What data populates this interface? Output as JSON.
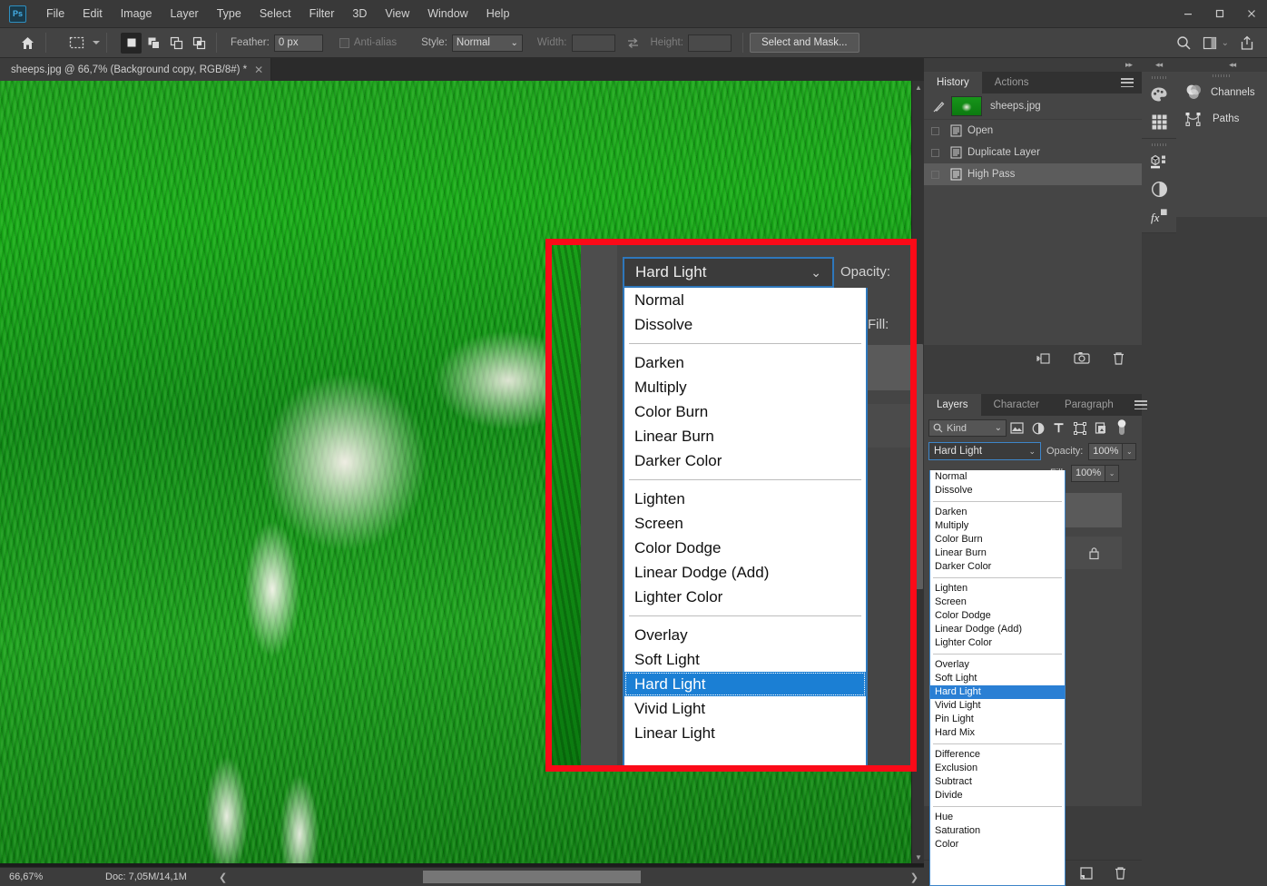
{
  "app": {
    "logo_text": "Ps",
    "menus": [
      "File",
      "Edit",
      "Image",
      "Layer",
      "Type",
      "Select",
      "Filter",
      "3D",
      "View",
      "Window",
      "Help"
    ],
    "window_controls": {
      "minimize": "—",
      "maximize": "◻",
      "close": "✕"
    }
  },
  "options_bar": {
    "home_icon": "home-icon",
    "tool_icon": "rectangular-marquee-icon",
    "selection_modes": [
      "new-selection",
      "add-to-selection",
      "subtract-from-selection",
      "intersect-selection"
    ],
    "feather_label": "Feather:",
    "feather_value": "0 px",
    "antialias_label": "Anti-alias",
    "antialias_checked": false,
    "style_label": "Style:",
    "style_value": "Normal",
    "width_label": "Width:",
    "width_value": "",
    "swap_icon": "swap-width-height-icon",
    "height_label": "Height:",
    "height_value": "",
    "select_and_mask_label": "Select and Mask...",
    "right_icons": [
      "search-icon",
      "workspace-icon",
      "share-icon"
    ]
  },
  "document": {
    "tab_title": "sheeps.jpg @ 66,7% (Background copy, RGB/8#) *",
    "close_glyph": "✕"
  },
  "status_bar": {
    "zoom": "66,67%",
    "doc_info": "Doc: 7,05M/14,1M",
    "expand_glyph": "❯",
    "left_arrow": "❮",
    "right_arrow": "❯"
  },
  "history_panel": {
    "tabs": [
      {
        "label": "History",
        "active": true
      },
      {
        "label": "Actions",
        "active": false
      }
    ],
    "menu_icon": "panel-menu-icon",
    "snapshot": {
      "label": "sheeps.jpg",
      "brush_icon": "history-brush-icon",
      "thumb": "document-thumbnail"
    },
    "states": [
      {
        "label": "Open",
        "selected": false,
        "icon": "history-state-icon"
      },
      {
        "label": "Duplicate Layer",
        "selected": false,
        "icon": "history-state-icon"
      },
      {
        "label": "High Pass",
        "selected": true,
        "icon": "history-state-icon"
      }
    ],
    "footer_icons": [
      "create-document-from-state-icon",
      "create-new-snapshot-icon",
      "delete-state-icon"
    ]
  },
  "icon_column": {
    "groups": [
      [
        "color-palette-icon",
        "swatches-grid-icon"
      ],
      [
        "properties-3d-icon",
        "adjustments-icon",
        "layer-styles-fx-icon"
      ]
    ]
  },
  "channels_paths": {
    "items": [
      {
        "label": "Channels",
        "icon": "channels-icon"
      },
      {
        "label": "Paths",
        "icon": "paths-icon"
      }
    ]
  },
  "layers_panel": {
    "tabs": [
      {
        "label": "Layers",
        "active": true
      },
      {
        "label": "Character",
        "active": false
      },
      {
        "label": "Paragraph",
        "active": false
      }
    ],
    "menu_icon": "panel-menu-icon",
    "filter": {
      "kind_label": "Kind",
      "search_icon": "search-icon",
      "chevron": "⌄",
      "filter_icons": [
        "filter-pixel-icon",
        "filter-adjustment-icon",
        "filter-type-icon",
        "filter-shape-icon",
        "filter-smart-object-icon"
      ],
      "toggle_icon": "filter-toggle-switch"
    },
    "blend_mode_value": "Hard Light",
    "blend_chevron": "⌄",
    "opacity_label": "Opacity:",
    "opacity_value": "100%",
    "fill_label": "Fill:",
    "fill_value": "100%",
    "lock_icon": "lock-icon",
    "footer_icons": [
      "new-layer-icon",
      "delete-layer-icon"
    ]
  },
  "blend_modes": {
    "selected": "Hard Light",
    "groups": [
      [
        "Normal",
        "Dissolve"
      ],
      [
        "Darken",
        "Multiply",
        "Color Burn",
        "Linear Burn",
        "Darker Color"
      ],
      [
        "Lighten",
        "Screen",
        "Color Dodge",
        "Linear Dodge (Add)",
        "Lighter Color"
      ],
      [
        "Overlay",
        "Soft Light",
        "Hard Light",
        "Vivid Light",
        "Pin Light",
        "Hard Mix"
      ],
      [
        "Difference",
        "Exclusion",
        "Subtract",
        "Divide"
      ],
      [
        "Hue",
        "Saturation",
        "Color"
      ]
    ]
  },
  "callout": {
    "border_color": "#fb0a18",
    "blend_mode_value": "Hard Light",
    "chevron": "⌄",
    "opacity_label": "Opacity:",
    "fill_label": "Fill:",
    "visible_modes": [
      [
        "Normal",
        "Dissolve"
      ],
      [
        "Darken",
        "Multiply",
        "Color Burn",
        "Linear Burn",
        "Darker Color"
      ],
      [
        "Lighten",
        "Screen",
        "Color Dodge",
        "Linear Dodge (Add)",
        "Lighter Color"
      ],
      [
        "Overlay",
        "Soft Light",
        "Hard Light",
        "Vivid Light",
        "Linear Light"
      ]
    ],
    "selected": "Hard Light"
  },
  "colors": {
    "accent_blue": "#2a7fd4",
    "callout_red": "#fb0a18",
    "panel_bg": "#3c3c3c",
    "panel_body": "#454545",
    "titlebar_bg": "#393939",
    "canvas_green": "#16a016"
  }
}
